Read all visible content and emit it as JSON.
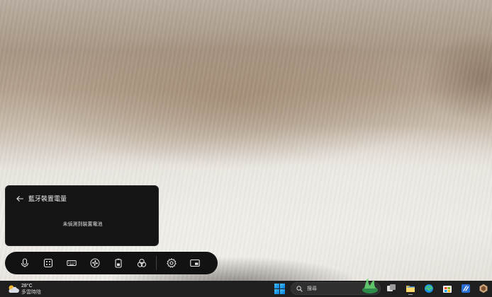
{
  "popup": {
    "title": "藍牙裝置電量",
    "message": "未偵測到裝置電池",
    "back_icon": "back-arrow-icon"
  },
  "toolbar": {
    "buttons": [
      {
        "name": "microphone",
        "icon": "microphone-icon"
      },
      {
        "name": "apps-grid",
        "icon": "grid-icon"
      },
      {
        "name": "keyboard",
        "icon": "keyboard-icon"
      },
      {
        "name": "fan",
        "icon": "fan-icon"
      },
      {
        "name": "battery",
        "icon": "battery-icon"
      },
      {
        "name": "color-filter",
        "icon": "color-circles-icon"
      },
      {
        "name": "settings",
        "icon": "gear-icon"
      },
      {
        "name": "picture-in-picture",
        "icon": "pip-icon"
      }
    ]
  },
  "taskbar": {
    "weather": {
      "temperature": "28°C",
      "condition": "多雲時陰",
      "icon": "partly-cloudy-icon"
    },
    "search": {
      "placeholder": "搜尋",
      "icon": "search-icon"
    },
    "apps": [
      {
        "name": "start",
        "icon": "windows-start-icon"
      },
      {
        "name": "task-view",
        "icon": "task-view-icon"
      },
      {
        "name": "edge",
        "icon": "edge-browser-icon"
      },
      {
        "name": "file-explorer",
        "icon": "folder-icon"
      },
      {
        "name": "microsoft-store",
        "icon": "store-icon"
      },
      {
        "name": "teams",
        "icon": "teams-icon"
      },
      {
        "name": "armoury-app",
        "icon": "gaming-app-icon"
      }
    ]
  },
  "colors": {
    "popup_bg": "#141414",
    "toolbar_bg": "#121212",
    "taskbar_bg": "#1f1f1f",
    "accent": "#0078d4"
  }
}
